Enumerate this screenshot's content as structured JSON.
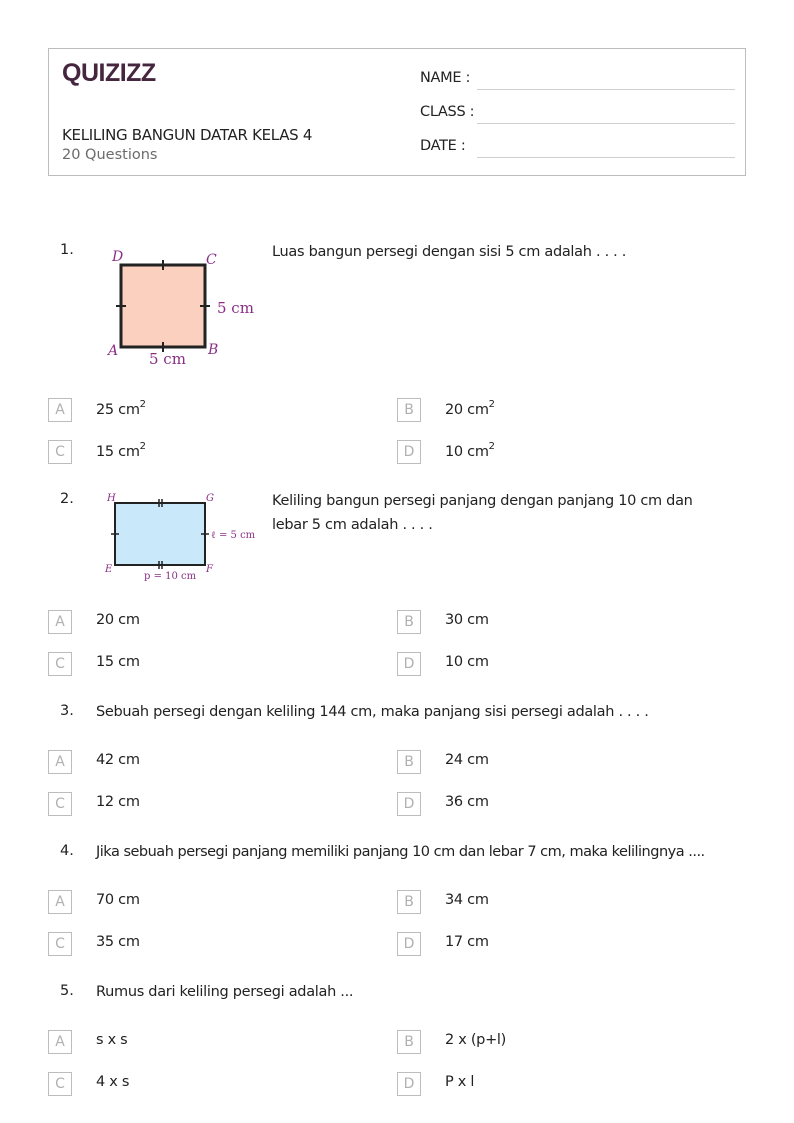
{
  "header": {
    "logo": "QUIZIZZ",
    "title": "KELILING BANGUN DATAR KELAS 4",
    "question_count": "20 Questions",
    "fields": [
      {
        "label": "NAME :"
      },
      {
        "label": "CLASS :"
      },
      {
        "label": "DATE  :"
      }
    ]
  },
  "questions": [
    {
      "number": "1.",
      "text": "Luas bangun persegi dengan sisi 5 cm adalah . . . .",
      "figure": {
        "type": "square",
        "fill": "#fbd0bf",
        "labels": {
          "tl": "D",
          "tr": "C",
          "bl": "A",
          "br": "B",
          "right": "5 cm",
          "bottom": "5 cm"
        }
      },
      "options": [
        {
          "letter": "A",
          "text": "25 cm",
          "sup": "2"
        },
        {
          "letter": "B",
          "text": "20 cm",
          "sup": "2"
        },
        {
          "letter": "C",
          "text": "15 cm",
          "sup": "2"
        },
        {
          "letter": "D",
          "text": "10 cm",
          "sup": "2"
        }
      ]
    },
    {
      "number": "2.",
      "text": "Keliling bangun persegi panjang dengan panjang 10 cm dan lebar 5 cm adalah . . . .",
      "figure": {
        "type": "rectangle",
        "fill": "#c9e8fa",
        "labels": {
          "tl": "H",
          "tr": "G",
          "bl": "E",
          "br": "F",
          "right": "ℓ = 5 cm",
          "bottom": "p = 10 cm"
        }
      },
      "options": [
        {
          "letter": "A",
          "text": "20 cm"
        },
        {
          "letter": "B",
          "text": "30 cm"
        },
        {
          "letter": "C",
          "text": "15 cm"
        },
        {
          "letter": "D",
          "text": "10 cm"
        }
      ]
    },
    {
      "number": "3.",
      "text": "Sebuah persegi dengan keliling 144 cm, maka panjang sisi persegi adalah . . . .",
      "options": [
        {
          "letter": "A",
          "text": "42 cm"
        },
        {
          "letter": "B",
          "text": "24 cm"
        },
        {
          "letter": "C",
          "text": "12 cm"
        },
        {
          "letter": "D",
          "text": "36 cm"
        }
      ]
    },
    {
      "number": "4.",
      "text": "Jika sebuah persegi panjang memiliki panjang 10 cm dan lebar 7 cm, maka kelilingnya ....",
      "options": [
        {
          "letter": "A",
          "text": "70 cm"
        },
        {
          "letter": "B",
          "text": "34 cm"
        },
        {
          "letter": "C",
          "text": "35 cm"
        },
        {
          "letter": "D",
          "text": "17 cm"
        }
      ]
    },
    {
      "number": "5.",
      "text": "Rumus dari keliling persegi adalah ...",
      "options": [
        {
          "letter": "A",
          "text": "s x s"
        },
        {
          "letter": "B",
          "text": "2 x (p+l)"
        },
        {
          "letter": "C",
          "text": "4 x s"
        },
        {
          "letter": "D",
          "text": "P x l"
        }
      ]
    }
  ]
}
